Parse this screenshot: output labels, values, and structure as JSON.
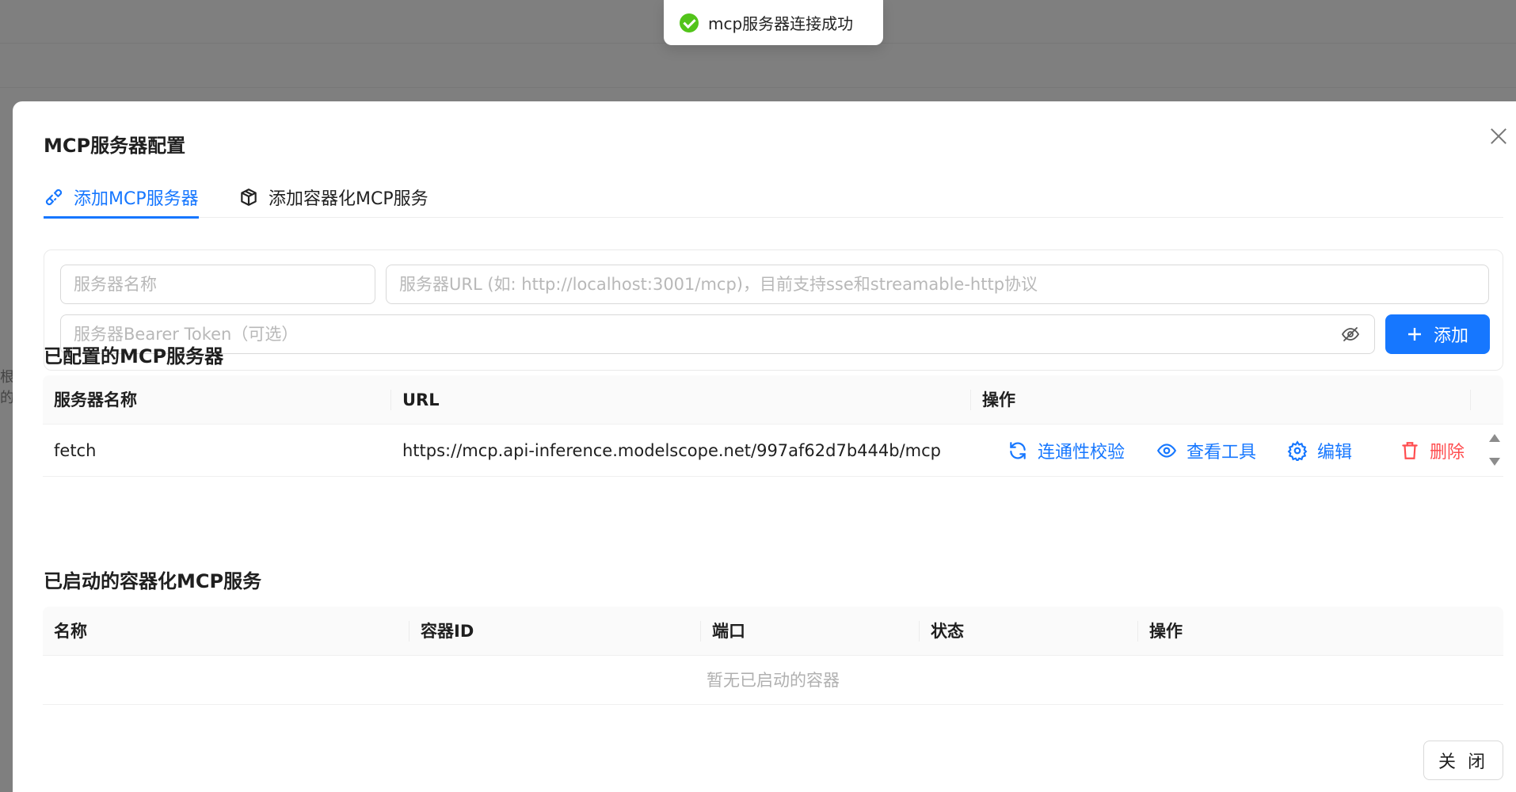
{
  "background": {
    "side_text_1": "根",
    "side_text_2": "的"
  },
  "toast": {
    "message": "mcp服务器连接成功",
    "icon": "check-circle-icon",
    "color": "#52c41a"
  },
  "modal": {
    "title": "MCP服务器配置",
    "tabs": [
      {
        "label": "添加MCP服务器",
        "icon": "link-icon",
        "active": true
      },
      {
        "label": "添加容器化MCP服务",
        "icon": "cube-icon",
        "active": false
      }
    ],
    "form": {
      "name_placeholder": "服务器名称",
      "url_placeholder": "服务器URL (如: http://localhost:3001/mcp)，目前支持sse和streamable-http协议",
      "token_placeholder": "服务器Bearer Token（可选）",
      "add_label": "添加"
    },
    "configured": {
      "title": "已配置的MCP服务器",
      "columns": [
        "服务器名称",
        "URL",
        "操作"
      ],
      "rows": [
        {
          "name": "fetch",
          "url": "https://mcp.api-inference.modelscope.net/997af62d7b444b/mcp",
          "actions": {
            "check": "连通性校验",
            "tools": "查看工具",
            "edit": "编辑",
            "delete": "删除"
          }
        }
      ]
    },
    "containers": {
      "title": "已启动的容器化MCP服务",
      "columns": [
        "名称",
        "容器ID",
        "端口",
        "状态",
        "操作"
      ],
      "empty_text": "暂无已启动的容器"
    },
    "close_label": "关 闭"
  },
  "colors": {
    "primary": "#1677ff",
    "danger": "#ff4d4f",
    "success": "#52c41a"
  }
}
